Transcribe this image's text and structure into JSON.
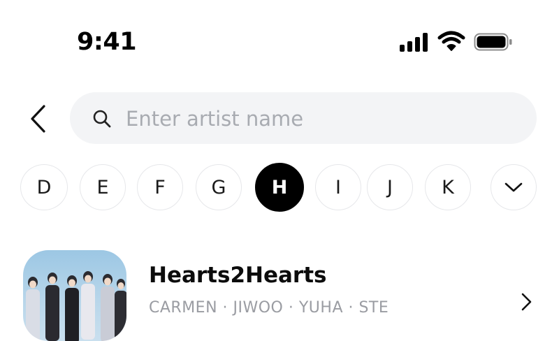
{
  "status_bar": {
    "time": "9:41",
    "icons": [
      "cellular-signal-icon",
      "wifi-icon",
      "battery-icon"
    ]
  },
  "search": {
    "back_icon": "chevron-left-icon",
    "search_icon": "search-icon",
    "placeholder": "Enter artist name",
    "value": ""
  },
  "alphabet": {
    "letters": [
      "D",
      "E",
      "F",
      "G",
      "H",
      "I",
      "J",
      "K"
    ],
    "selected": "H",
    "expand_icon": "chevron-down-icon"
  },
  "artists": [
    {
      "name": "Hearts2Hearts",
      "members": "CARMEN · JIWOO · YUHA · STE",
      "chevron_icon": "chevron-right-icon"
    }
  ],
  "colors": {
    "search_bg": "#f3f4f6",
    "placeholder": "#a8abb1",
    "chip_border": "#e6e7ea",
    "chip_active_bg": "#000000",
    "members_text": "#9a9ca2"
  }
}
